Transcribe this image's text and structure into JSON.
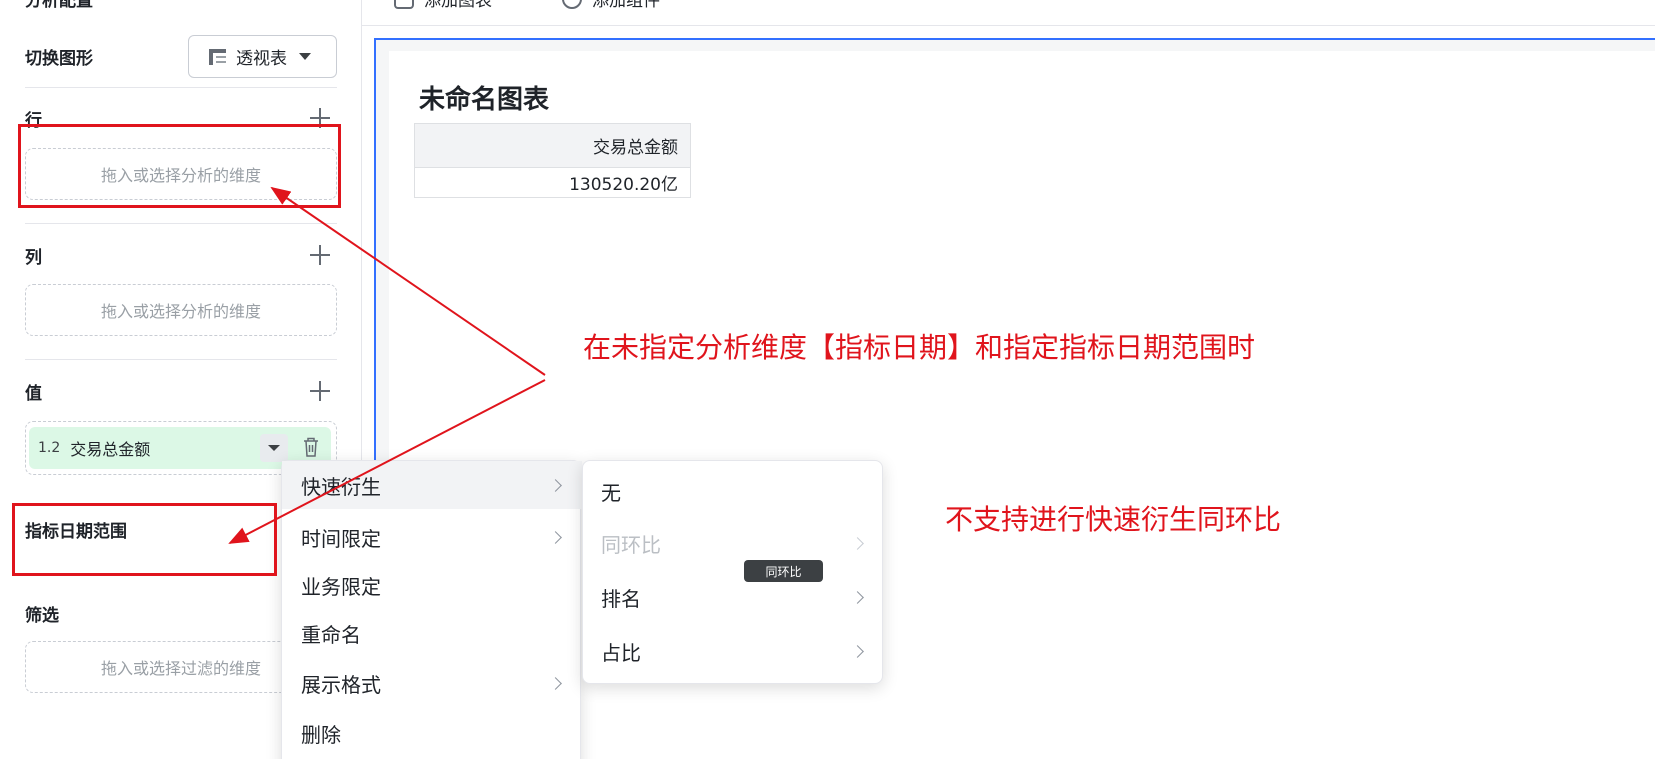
{
  "panel": {
    "title": "分析配置",
    "switch_chart_label": "切换图形",
    "chart_type_value": "透视表",
    "rows_label": "行",
    "rows_placeholder": "拖入或选择分析的维度",
    "cols_label": "列",
    "cols_placeholder": "拖入或选择分析的维度",
    "values_label": "值",
    "value_chip": {
      "type_icon": "1.2",
      "name": "交易总金额"
    },
    "date_range_label": "指标日期范围",
    "filter_label": "筛选",
    "filter_placeholder": "拖入或选择过滤的维度"
  },
  "toolbar": {
    "add_chart": "添加图表",
    "add_component": "添加组件"
  },
  "chart": {
    "title": "未命名图表",
    "table_header": "交易总金额",
    "table_value": "130520.20亿"
  },
  "context_menu": {
    "items": [
      {
        "label": "快速衍生"
      },
      {
        "label": "时间限定"
      },
      {
        "label": "业务限定"
      },
      {
        "label": "重命名"
      },
      {
        "label": "展示格式"
      },
      {
        "label": "删除"
      }
    ]
  },
  "sub_menu": {
    "items": [
      {
        "label": "无"
      },
      {
        "label": "同环比"
      },
      {
        "label": "排名"
      },
      {
        "label": "占比"
      }
    ],
    "tooltip": "同环比"
  },
  "annotations": {
    "text_1": "在未指定分析维度【指标日期】和指定指标日期范围时",
    "text_2": "不支持进行快速衍生同环比",
    "color": "#e0141c"
  },
  "colors": {
    "accent": "#3370ff",
    "value_chip_bg": "#dcf8e6"
  }
}
